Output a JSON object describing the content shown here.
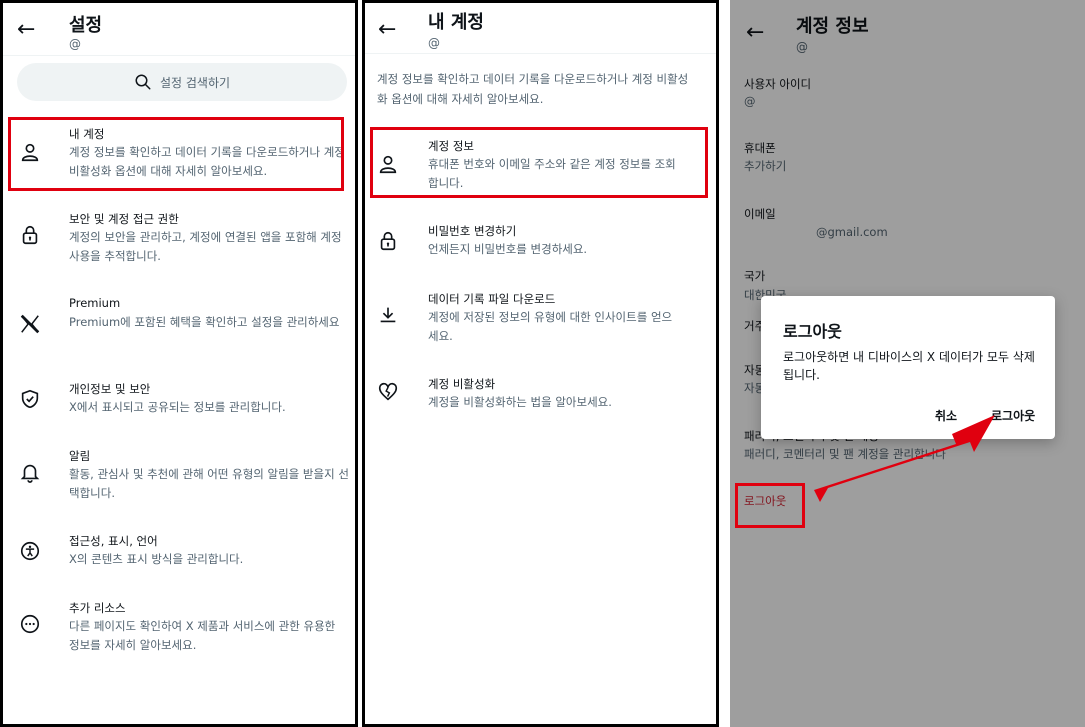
{
  "panel1": {
    "title": "설정",
    "handle": "@",
    "search_placeholder": "설정 검색하기",
    "items": [
      {
        "title": "내 계정",
        "desc": "계정 정보를 확인하고 데이터 기록을 다운로드하거나 계정 비활성화 옵션에 대해 자세히 알아보세요.",
        "icon": "person-icon"
      },
      {
        "title": "보안 및 계정 접근 권한",
        "desc": "계정의 보안을 관리하고, 계정에 연결된 앱을 포함해 계정 사용을 추적합니다.",
        "icon": "lock-icon"
      },
      {
        "title": "Premium",
        "desc": "Premium에 포함된 혜택을 확인하고 설정을 관리하세요",
        "icon": "x-logo-icon"
      },
      {
        "title": "개인정보 및 보안",
        "desc": "X에서 표시되고 공유되는 정보를 관리합니다.",
        "icon": "shield-check-icon"
      },
      {
        "title": "알림",
        "desc": "활동, 관심사 및 추천에 관해 어떤 유형의 알림을 받을지 선택합니다.",
        "icon": "bell-icon"
      },
      {
        "title": "접근성, 표시, 언어",
        "desc": "X의 콘텐츠 표시 방식을 관리합니다.",
        "icon": "accessibility-icon"
      },
      {
        "title": "추가 리소스",
        "desc": "다른 페이지도 확인하여 X 제품과 서비스에 관한 유용한 정보를 자세히 알아보세요.",
        "icon": "more-circle-icon"
      }
    ]
  },
  "panel2": {
    "title": "내 계정",
    "handle": "@",
    "intro": "계정 정보를 확인하고 데이터 기록을 다운로드하거나 계정 비활성화 옵션에 대해 자세히 알아보세요.",
    "items": [
      {
        "title": "계정 정보",
        "desc": "휴대폰 번호와 이메일 주소와 같은 계정 정보를 조회합니다.",
        "icon": "person-icon"
      },
      {
        "title": "비밀번호 변경하기",
        "desc": "언제든지 비밀번호를 변경하세요.",
        "icon": "lock-icon"
      },
      {
        "title": "데이터 기록 파일 다운로드",
        "desc": "계정에 저장된 정보의 유형에 대한 인사이트를 얻으세요.",
        "icon": "download-icon"
      },
      {
        "title": "계정 비활성화",
        "desc": "계정을 비활성화하는 법을 알아보세요.",
        "icon": "broken-heart-icon"
      }
    ]
  },
  "panel3": {
    "title": "계정 정보",
    "handle": "@",
    "fields": [
      {
        "label": "사용자 아이디",
        "value": "@"
      },
      {
        "label": "휴대폰",
        "value": "추가하기"
      },
      {
        "label": "이메일",
        "value": "@gmail.com"
      },
      {
        "label": "국가",
        "value": "대한민국"
      },
      {
        "label": "거주",
        "value": ""
      },
      {
        "label": "자동",
        "value": "자동"
      },
      {
        "label": "패러디, 코멘터리 및 팬 계정",
        "value": "패러디, 코멘터리 및 팬 계정을 관리합니다"
      }
    ],
    "logout_link": "로그아웃",
    "dialog": {
      "title": "로그아웃",
      "body": "로그아웃하면 내 디바이스의 X 데이터가 모두 삭제됩니다.",
      "cancel": "취소",
      "confirm": "로그아웃"
    }
  },
  "colors": {
    "highlight_red": "#e0000f",
    "link_red": "#d32232",
    "secondary_text": "#536471"
  }
}
